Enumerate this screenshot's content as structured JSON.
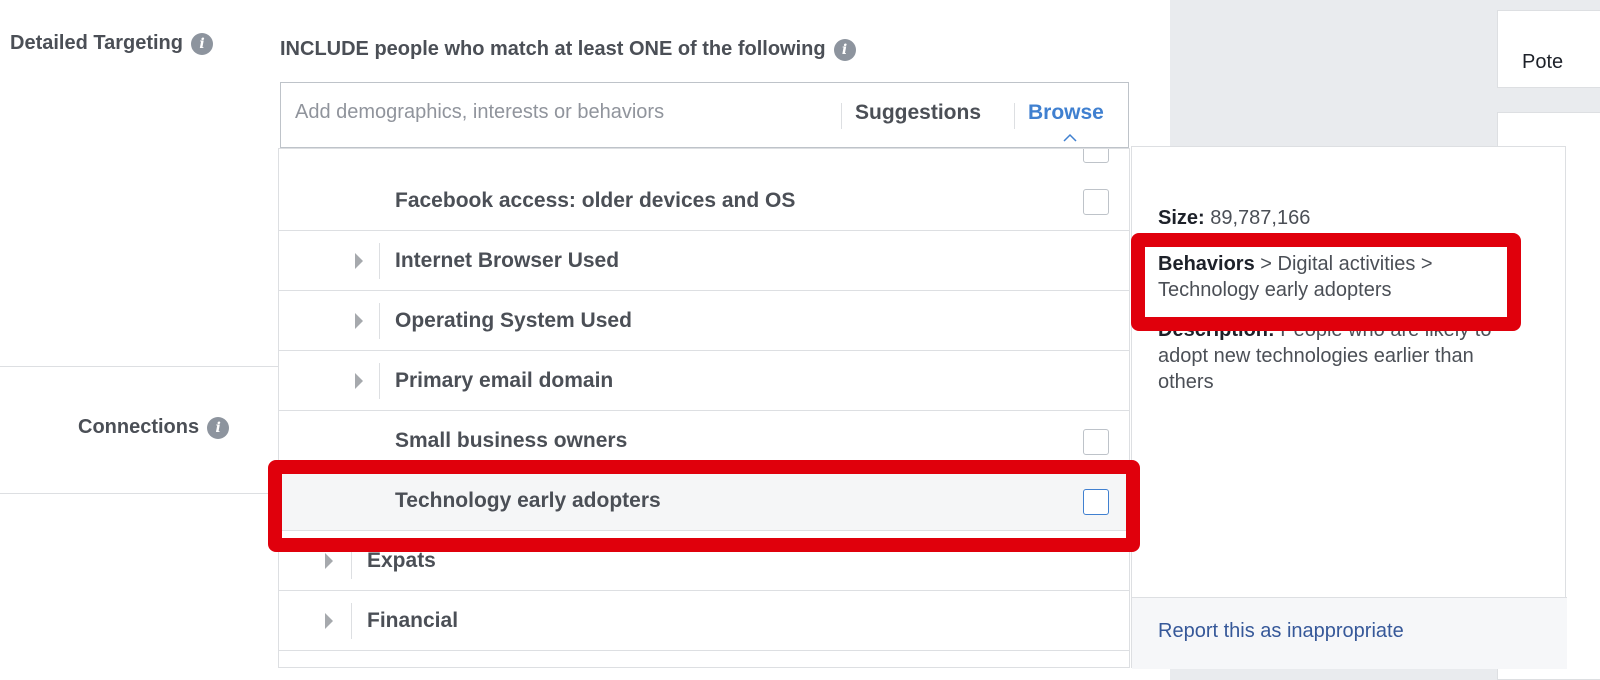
{
  "labels": {
    "detailed_targeting": "Detailed Targeting",
    "connections": "Connections"
  },
  "include_heading": "INCLUDE people who match at least ONE of the following",
  "search": {
    "placeholder": "Add demographics, interests or behaviors",
    "suggestions_label": "Suggestions",
    "browse_label": "Browse"
  },
  "list": {
    "items": [
      {
        "label": "Facebook access: older devices and OS"
      },
      {
        "label": "Internet Browser Used"
      },
      {
        "label": "Operating System Used"
      },
      {
        "label": "Primary email domain"
      },
      {
        "label": "Small business owners"
      },
      {
        "label": "Technology early adopters"
      },
      {
        "label": "Expats"
      },
      {
        "label": "Financial"
      }
    ]
  },
  "details": {
    "size_label": "Size:",
    "size_value": "89,787,166",
    "path_root": "Behaviors",
    "path_rest": " > Digital activities > Technology early adopters",
    "description_label": "Description:",
    "description_value": "People who are likely to adopt new technologies earlier than others",
    "report_link": "Report this as inappropriate"
  },
  "right_panel": {
    "partial_text": "Pote"
  },
  "colors": {
    "accent": "#4080d0",
    "annotation": "#e0000c",
    "link": "#365899"
  }
}
